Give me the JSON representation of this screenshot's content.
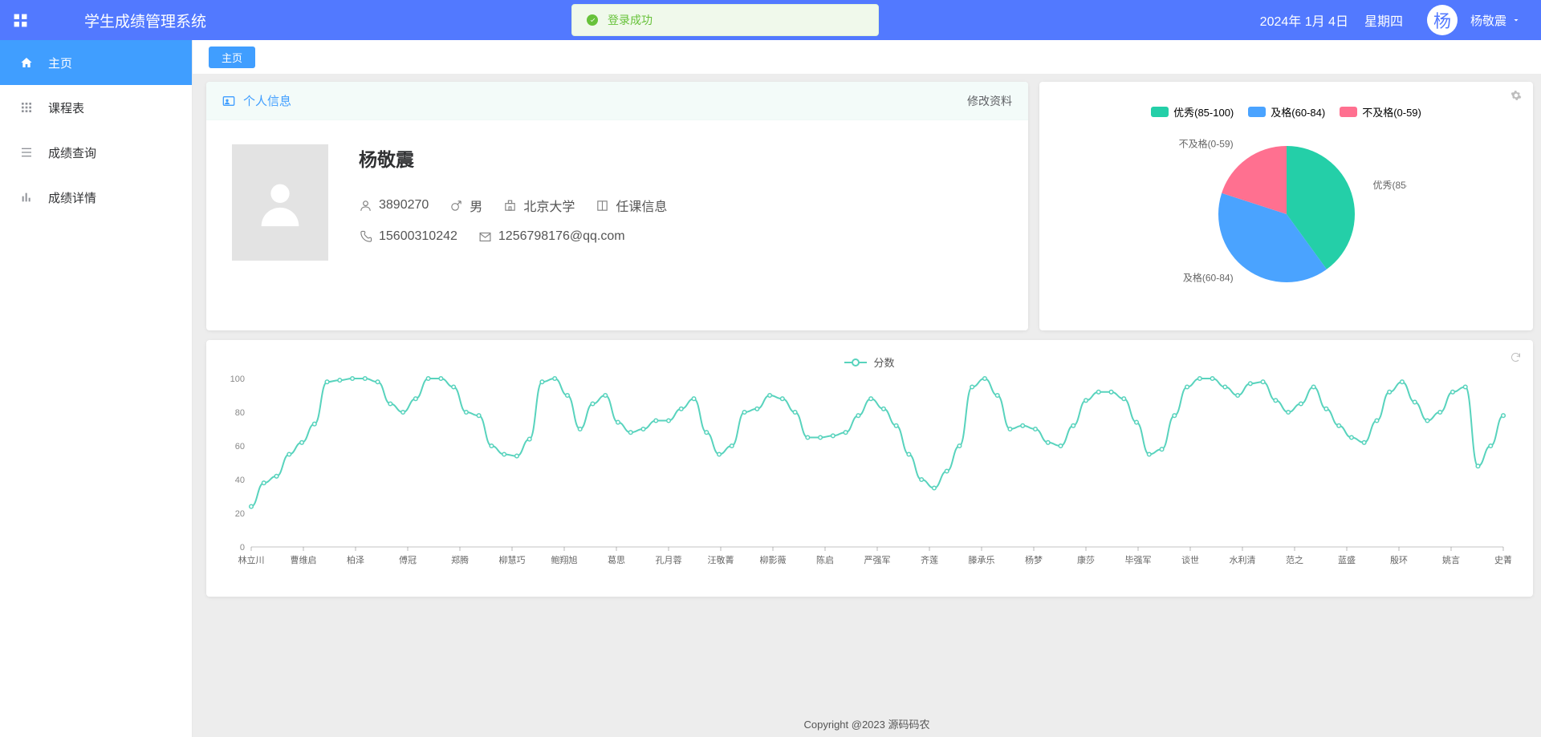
{
  "header": {
    "title": "学生成绩管理系统",
    "login_msg": "登录成功",
    "date": "2024年 1月 4日",
    "weekday": "星期四",
    "avatar_char": "杨",
    "user_name": "杨敬震"
  },
  "sidebar": {
    "items": [
      {
        "label": "主页"
      },
      {
        "label": "课程表"
      },
      {
        "label": "成绩查询"
      },
      {
        "label": "成绩详情"
      }
    ]
  },
  "tabs": {
    "active": "主页"
  },
  "profile_card": {
    "header_title": "个人信息",
    "edit_label": "修改资料",
    "name": "杨敬震",
    "id": "3890270",
    "gender": "男",
    "school": "北京大学",
    "class_btn": "任课信息",
    "phone": "15600310242",
    "email": "1256798176@qq.com"
  },
  "chart_data": [
    {
      "type": "pie",
      "title": "",
      "series": [
        {
          "name": "优秀(85-100)",
          "value": 40,
          "color": "#24cfa8"
        },
        {
          "name": "及格(60-84)",
          "value": 40,
          "color": "#4aa3ff"
        },
        {
          "name": "不及格(0-59)",
          "value": 20,
          "color": "#ff7090"
        }
      ],
      "labels": {
        "excellent": "优秀(85-100)",
        "pass": "及格(60-84)",
        "fail": "不及格(0-59)"
      }
    },
    {
      "type": "line",
      "title": "",
      "series_name": "分数",
      "ylabel": "",
      "xlabel": "",
      "ylim": [
        0,
        100
      ],
      "yticks": [
        0,
        20,
        40,
        60,
        80,
        100
      ],
      "color": "#58d3bd",
      "categories": [
        "林立川",
        "曹维启",
        "柏泽",
        "傅冠",
        "郑腾",
        "柳慧巧",
        "鲍翔旭",
        "葛思",
        "孔月蓉",
        "汪敬菁",
        "柳影薇",
        "陈启",
        "严强军",
        "齐莲",
        "滕承乐",
        "杨梦",
        "康莎",
        "毕强军",
        "谈世",
        "水利清",
        "范之",
        "蓝盛",
        "殷环",
        "姚言",
        "史菁"
      ],
      "x": [
        0,
        1,
        2,
        3,
        4,
        5,
        6,
        7,
        8,
        9,
        10,
        11,
        12,
        13,
        14,
        15,
        16,
        17,
        18,
        19,
        20,
        21,
        22,
        23,
        24,
        25,
        26,
        27,
        28,
        29,
        30,
        31,
        32,
        33,
        34,
        35,
        36,
        37,
        38,
        39,
        40,
        41,
        42,
        43,
        44,
        45,
        46,
        47,
        48,
        49,
        50,
        51,
        52,
        53,
        54,
        55,
        56,
        57,
        58,
        59,
        60,
        61,
        62,
        63,
        64,
        65,
        66,
        67,
        68,
        69,
        70,
        71,
        72,
        73,
        74,
        75,
        76,
        77,
        78,
        79,
        80,
        81,
        82,
        83,
        84,
        85,
        86,
        87,
        88,
        89,
        90,
        91,
        92,
        93,
        94,
        95,
        96,
        97,
        98,
        99
      ],
      "values": [
        24,
        38,
        42,
        55,
        62,
        73,
        98,
        99,
        100,
        100,
        98,
        85,
        80,
        88,
        100,
        100,
        95,
        80,
        78,
        60,
        55,
        54,
        64,
        98,
        100,
        90,
        70,
        85,
        90,
        74,
        68,
        70,
        75,
        75,
        82,
        88,
        68,
        55,
        60,
        80,
        82,
        90,
        88,
        80,
        65,
        65,
        66,
        68,
        78,
        88,
        82,
        72,
        55,
        40,
        35,
        45,
        60,
        95,
        100,
        90,
        70,
        72,
        70,
        62,
        60,
        72,
        87,
        92,
        92,
        88,
        74,
        55,
        58,
        78,
        95,
        100,
        100,
        95,
        90,
        97,
        98,
        87,
        80,
        85,
        95,
        82,
        72,
        65,
        62,
        75,
        92,
        98,
        86,
        75,
        80,
        92,
        95,
        48,
        60,
        78
      ]
    }
  ],
  "footer": {
    "text": "Copyright @2023 源码码农"
  }
}
